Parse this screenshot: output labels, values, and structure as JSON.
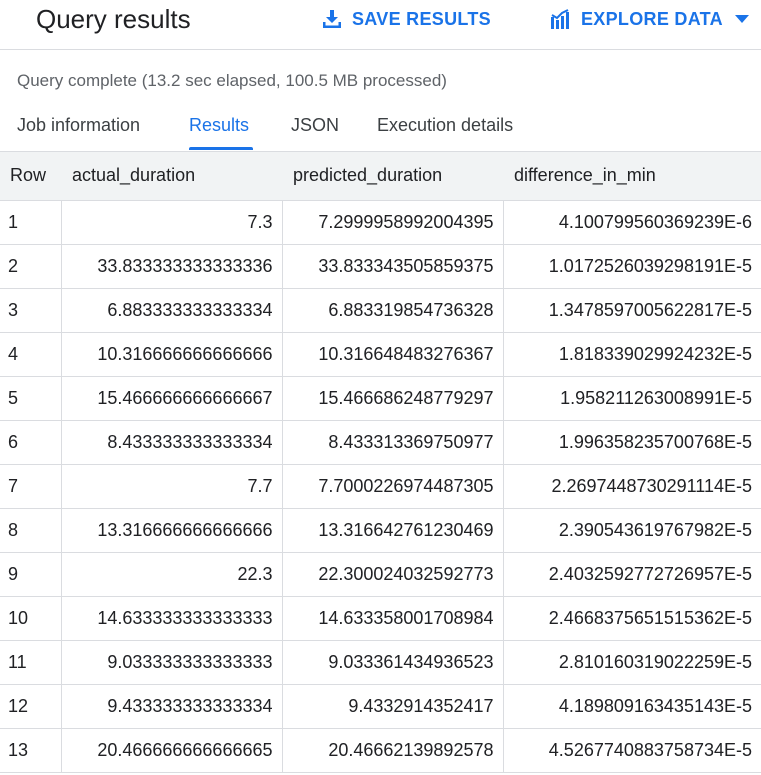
{
  "header": {
    "title": "Query results",
    "save_label": "SAVE RESULTS",
    "explore_label": "EXPLORE DATA",
    "accent_color": "#1a73e8"
  },
  "status": "Query complete (13.2 sec elapsed, 100.5 MB processed)",
  "tabs": [
    {
      "label": "Job information",
      "active": false
    },
    {
      "label": "Results",
      "active": true
    },
    {
      "label": "JSON",
      "active": false
    },
    {
      "label": "Execution details",
      "active": false
    }
  ],
  "table": {
    "columns": [
      "Row",
      "actual_duration",
      "predicted_duration",
      "difference_in_min"
    ],
    "rows": [
      [
        "1",
        "7.3",
        "7.2999958992004395",
        "4.100799560369239E-6"
      ],
      [
        "2",
        "33.833333333333336",
        "33.833343505859375",
        "1.0172526039298191E-5"
      ],
      [
        "3",
        "6.883333333333334",
        "6.883319854736328",
        "1.3478597005622817E-5"
      ],
      [
        "4",
        "10.316666666666666",
        "10.316648483276367",
        "1.818339029924232E-5"
      ],
      [
        "5",
        "15.466666666666667",
        "15.466686248779297",
        "1.958211263008991E-5"
      ],
      [
        "6",
        "8.433333333333334",
        "8.433313369750977",
        "1.996358235700768E-5"
      ],
      [
        "7",
        "7.7",
        "7.7000226974487305",
        "2.2697448730291114E-5"
      ],
      [
        "8",
        "13.316666666666666",
        "13.316642761230469",
        "2.390543619767982E-5"
      ],
      [
        "9",
        "22.3",
        "22.300024032592773",
        "2.4032592772726957E-5"
      ],
      [
        "10",
        "14.633333333333333",
        "14.633358001708984",
        "2.4668375651515362E-5"
      ],
      [
        "11",
        "9.033333333333333",
        "9.033361434936523",
        "2.810160319022259E-5"
      ],
      [
        "12",
        "9.433333333333334",
        "9.4332914352417",
        "4.189809163435143E-5"
      ],
      [
        "13",
        "20.466666666666665",
        "20.46662139892578",
        "4.5267740883758734E-5"
      ]
    ]
  }
}
